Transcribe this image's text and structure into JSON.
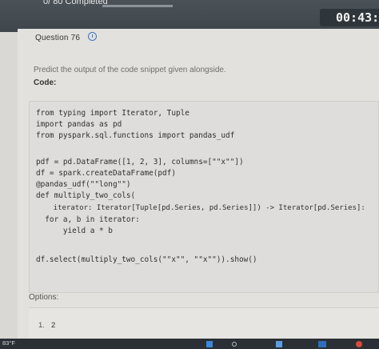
{
  "header": {
    "progress_text": "0/ 80 Completed",
    "progress_fraction": 0.0,
    "timer": "00:43:"
  },
  "question": {
    "title": "Question 76",
    "prompt": "Predict the output of the code snippet given alongside.",
    "code_label": "Code:",
    "code_lines": [
      "from typing import Iterator, Tuple",
      "import pandas as pd",
      "from pyspark.sql.functions import pandas_udf",
      "pdf = pd.DataFrame([1, 2, 3], columns=[\"\"x\"\"])",
      "df = spark.createDataFrame(pdf)",
      "@pandas_udf(\"\"long\"\")",
      "def multiply_two_cols(",
      "    iterator: Iterator[Tuple[pd.Series, pd.Series]]) -> Iterator[pd.Series]:",
      "  for a, b in iterator:",
      "      yield a * b",
      "df.select(multiply_two_cols(\"\"x\"\", \"\"x\"\")).show()"
    ]
  },
  "options": {
    "label": "Options:",
    "items": [
      {
        "number": "1.",
        "value": "2"
      }
    ]
  },
  "taskbar": {
    "temperature": "83°F"
  }
}
